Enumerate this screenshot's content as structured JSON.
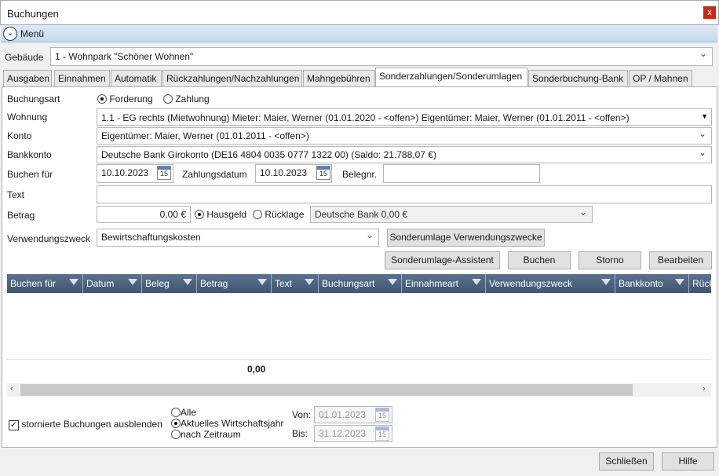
{
  "window": {
    "title": "Buchungen",
    "close": "x"
  },
  "menu": {
    "label": "Menü"
  },
  "gebaeude": {
    "label": "Gebäude",
    "value": "1 - Wohnpark \"Schöner Wohnen\""
  },
  "tabs": [
    "Ausgaben",
    "Einnahmen",
    "Automatik",
    "Rückzahlungen/Nachzahlungen",
    "Mahngebühren",
    "Sonderzahlungen/Sonderumlagen",
    "Sonderbuchung-Bank",
    "OP / Mahnen"
  ],
  "form": {
    "buchungsart_label": "Buchungsart",
    "forderung": "Forderung",
    "zahlung": "Zahlung",
    "wohnung_label": "Wohnung",
    "wohnung_value": "1.1 - EG rechts (Mietwohnung)    Mieter: Maier, Werner (01.01.2020 - <offen>)    Eigentümer: Maier, Werner (01.01.2011 - <offen>)",
    "konto_label": "Konto",
    "konto_value": "Eigentümer: Maier, Werner (01.01.2011 - <offen>)",
    "bankkonto_label": "Bankkonto",
    "bankkonto_value": "Deutsche Bank Girokonto (DE16 4804 0035 0777 1322 00) (Saldo: 21.788,07 €)",
    "buchen_fuer_label": "Buchen für",
    "buchen_fuer_value": "10.10.2023",
    "zahlungsdatum_label": "Zahlungsdatum",
    "zahlungsdatum_value": "10.10.2023",
    "belegnr_label": "Belegnr.",
    "text_label": "Text",
    "betrag_label": "Betrag",
    "betrag_value": "0,00 €",
    "hausgeld": "Hausgeld",
    "ruecklage": "Rücklage",
    "ruecklage_konto": "Deutsche Bank 0,00 €",
    "verwendungszweck_label": "Verwendungszweck",
    "verwendungszweck_value": "Bewirtschaftungskosten",
    "cal_day": "15"
  },
  "buttons": {
    "sonderumlage_vz": "Sonderumlage Verwendungszwecke",
    "assistent": "Sonderumlage-Assistent",
    "buchen": "Buchen",
    "storno": "Storno",
    "bearbeiten": "Bearbeiten",
    "schliessen": "Schließen",
    "hilfe": "Hilfe"
  },
  "grid": {
    "columns": [
      "Buchen für",
      "Datum",
      "Beleg",
      "Betrag",
      "Text",
      "Buchungsart",
      "Einnahmeart",
      "Verwendungszweck",
      "Bankkonto",
      "Rück"
    ],
    "total": "0,00"
  },
  "footer": {
    "hide_storno": "stornierte Buchungen ausblenden",
    "alle": "Alle",
    "aktuelles": "Aktuelles Wirtschaftsjahr",
    "zeitraum": "nach Zeitraum",
    "von_label": "Von:",
    "von_value": "01.01.2023",
    "bis_label": "Bis:",
    "bis_value": "31.12.2023"
  }
}
